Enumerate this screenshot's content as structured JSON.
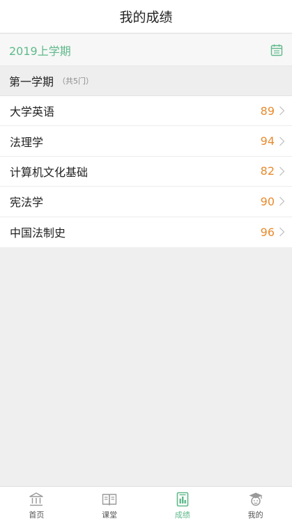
{
  "header": {
    "title": "我的成绩"
  },
  "semester": {
    "label": "2019上学期",
    "icon": "calendar-icon"
  },
  "section": {
    "term": "第一学期",
    "count": "（共5门）"
  },
  "courses": [
    {
      "name": "大学英语",
      "score": "89"
    },
    {
      "name": "法理学",
      "score": "94"
    },
    {
      "name": "计算机文化基础",
      "score": "82"
    },
    {
      "name": "宪法学",
      "score": "90"
    },
    {
      "name": "中国法制史",
      "score": "96"
    }
  ],
  "tabs": [
    {
      "label": "首页",
      "icon": "home-icon",
      "active": false
    },
    {
      "label": "课堂",
      "icon": "book-icon",
      "active": false
    },
    {
      "label": "成绩",
      "icon": "report-icon",
      "active": true
    },
    {
      "label": "我的",
      "icon": "student-icon",
      "active": false
    }
  ],
  "colors": {
    "accent": "#5fb98a",
    "score": "#e88a2e"
  }
}
